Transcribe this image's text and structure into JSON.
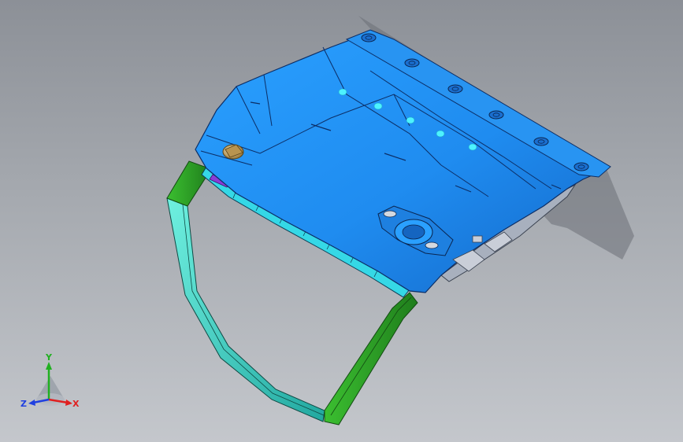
{
  "viewport": {
    "model_name": "",
    "colors": {
      "background_top": "#8c9097",
      "background_bottom": "#c4c7cc",
      "door_panel": "#1f8cf0",
      "door_panel_dark": "#1565c0",
      "frame_green": "#2fa82a",
      "frame_cyan": "#3fd6c8",
      "seal_strip": "#35e0e6",
      "latch_gold": "#d9b36a",
      "highlight_cyan": "#4df2ff",
      "edge_line": "#0c2e66"
    }
  },
  "triad": {
    "x_label": "X",
    "y_label": "Y",
    "z_label": "Z",
    "x_color": "#e02020",
    "y_color": "#20b020",
    "z_color": "#2040e0"
  }
}
